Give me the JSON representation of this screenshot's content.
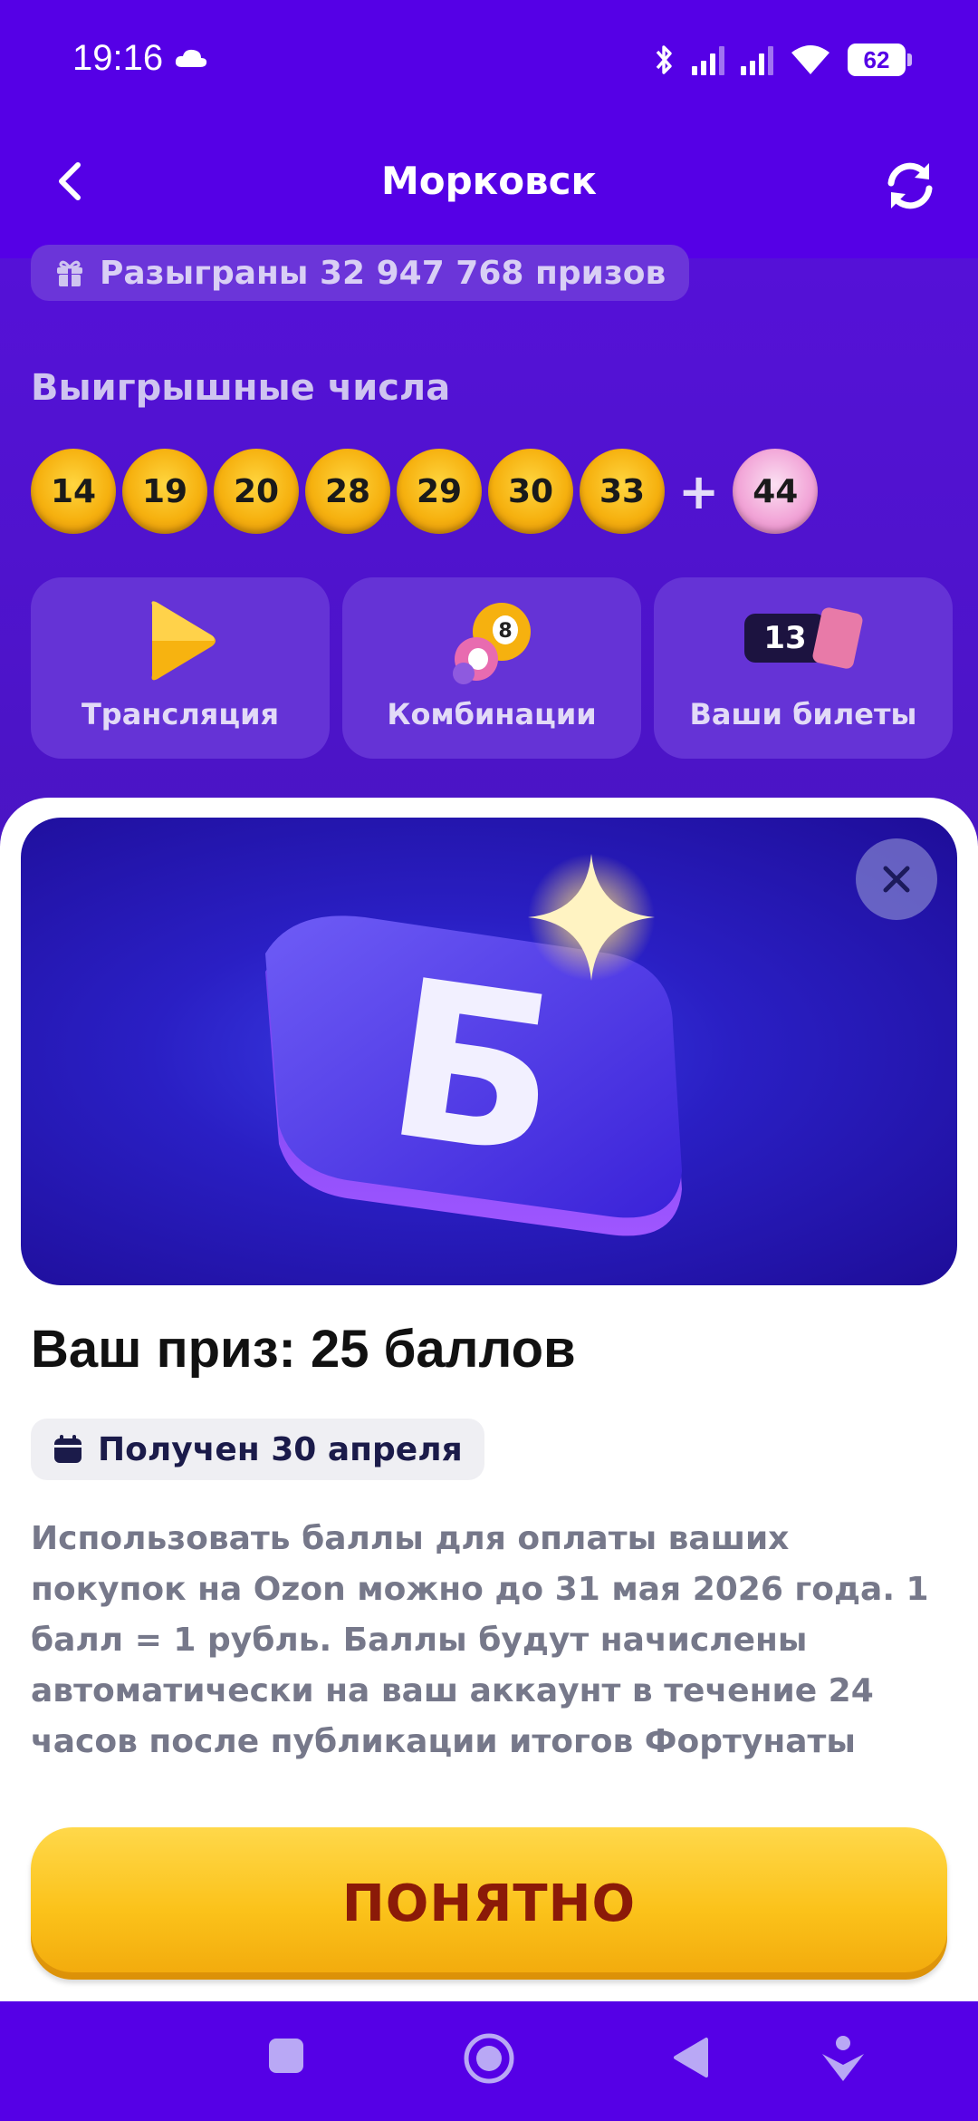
{
  "status_bar": {
    "time": "19:16",
    "battery": "62"
  },
  "header": {
    "title": "Морковск"
  },
  "draw": {
    "prizes_played": "Разыграны 32 947 768 призов",
    "winning_numbers_title": "Выигрышные числа",
    "winning_numbers": [
      "14",
      "19",
      "20",
      "28",
      "29",
      "30",
      "33"
    ],
    "plus_sign": "+",
    "bonus_number": "44"
  },
  "actions": [
    {
      "label": "Трансляция",
      "icon": "play-icon"
    },
    {
      "label": "Комбинации",
      "icon": "lottery-balls-icon"
    },
    {
      "label": "Ваши билеты",
      "icon": "tickets-icon",
      "count": "13"
    }
  ],
  "sheet": {
    "hero_letter": "Б",
    "prize_title": "Ваш приз: 25 баллов",
    "received_label": "Получен 30 апреля",
    "description": "Использовать баллы для оплаты ваших покупок на Ozon можно до 31 мая 2026 года. 1 балл = 1 рубль. Баллы будут начислены автоматически на ваш аккаунт в течение 24 часов после публикации итогов Фортунаты",
    "confirm_label": "ПОНЯТНО"
  },
  "colors": {
    "brand_purple": "#5500e6",
    "button_yellow": "#fbc21a",
    "button_text": "#8b1a08"
  }
}
